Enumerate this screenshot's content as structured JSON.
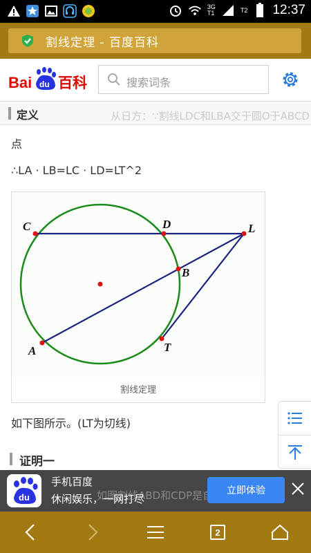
{
  "status_bar": {
    "time": "12:37",
    "net_3g": "3G",
    "net_t1": "T1",
    "net_t2": "T2",
    "icons": [
      "warning-icon",
      "star-app-icon",
      "gallery-icon",
      "headset-app-icon",
      "coin-app-icon",
      "alarm-icon",
      "wifi-icon",
      "signal-icon",
      "battery-icon"
    ]
  },
  "title_bar": {
    "title": "割线定理 - 百度百科",
    "secure_icon": "shield-check-icon"
  },
  "header": {
    "logo_text_bai": "Bai",
    "logo_text_du": "du",
    "logo_text_baike": "百科",
    "search_placeholder": "搜索词条",
    "settings_icon": "gear-icon"
  },
  "content": {
    "section1_title": "定义",
    "section1_ghost": "从日方：∵割线LDC和LBA交于圆O于ABCD",
    "line_point": "点",
    "line_formula": "∴LA · LB=LC · LD=LT^2",
    "figure": {
      "caption": "割线定理",
      "labels": {
        "C": "C",
        "D": "D",
        "L": "L",
        "B": "B",
        "A": "A",
        "T": "T"
      }
    },
    "line_note": "如下图所示。(LT为切线)",
    "section2_title": "证明一"
  },
  "side_buttons": {
    "catalog_icon": "list-icon",
    "top_icon": "back-to-top-icon"
  },
  "promo": {
    "app_name": "手机百度",
    "tagline": "休闲娱乐，一网打尽",
    "ghost_text": "如图割线ABD和CDP是自点P引的",
    "cta": "立即体验"
  },
  "nav": {
    "tab_count": "2"
  },
  "colors": {
    "gold_dark": "#a37a12",
    "gold_light": "#d0a43a",
    "baidu_red": "#e10602",
    "baidu_blue": "#2932e1",
    "accent_blue": "#3a86f5",
    "circle_green": "#1a8a1a",
    "line_navy": "#1a237e"
  }
}
